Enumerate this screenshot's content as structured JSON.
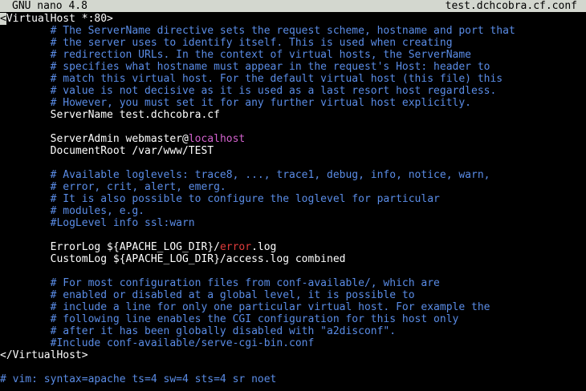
{
  "titlebar": {
    "app": "GNU nano 4.8",
    "filename": "test.dchcobra.cf.conf"
  },
  "colors": {
    "titlebar_bg": "#d3d7cf",
    "background": "#000000",
    "comment": "#5a8ce6",
    "text": "#ffffff",
    "host_highlight": "#d362ce",
    "error_highlight": "#e03c3c"
  },
  "editor": {
    "cursor_char": "<",
    "lines": [
      {
        "segments": [
          {
            "text": "VirtualHost *:80>",
            "style": "plain"
          }
        ],
        "cursor": true
      },
      {
        "segments": [
          {
            "text": "        # The ServerName directive sets the request scheme, hostname and port that",
            "style": "comment"
          }
        ]
      },
      {
        "segments": [
          {
            "text": "        # the server uses to identify itself. This is used when creating",
            "style": "comment"
          }
        ]
      },
      {
        "segments": [
          {
            "text": "        # redirection URLs. In the context of virtual hosts, the ServerName",
            "style": "comment"
          }
        ]
      },
      {
        "segments": [
          {
            "text": "        # specifies what hostname must appear in the request's Host: header to",
            "style": "comment"
          }
        ]
      },
      {
        "segments": [
          {
            "text": "        # match this virtual host. For the default virtual host (this file) this",
            "style": "comment"
          }
        ]
      },
      {
        "segments": [
          {
            "text": "        # value is not decisive as it is used as a last resort host regardless.",
            "style": "comment"
          }
        ]
      },
      {
        "segments": [
          {
            "text": "        # However, you must set it for any further virtual host explicitly.",
            "style": "comment"
          }
        ]
      },
      {
        "segments": [
          {
            "text": "        ServerName test.dchcobra.cf",
            "style": "plain"
          }
        ]
      },
      {
        "segments": []
      },
      {
        "segments": [
          {
            "text": "        ServerAdmin webmaster@",
            "style": "plain"
          },
          {
            "text": "localhost",
            "style": "host"
          }
        ]
      },
      {
        "segments": [
          {
            "text": "        DocumentRoot /var/www/TEST",
            "style": "plain"
          }
        ]
      },
      {
        "segments": []
      },
      {
        "segments": [
          {
            "text": "        # Available loglevels: trace8, ..., trace1, debug, info, notice, warn,",
            "style": "comment"
          }
        ]
      },
      {
        "segments": [
          {
            "text": "        # error, crit, alert, emerg.",
            "style": "comment"
          }
        ]
      },
      {
        "segments": [
          {
            "text": "        # It is also possible to configure the loglevel for particular",
            "style": "comment"
          }
        ]
      },
      {
        "segments": [
          {
            "text": "        # modules, e.g.",
            "style": "comment"
          }
        ]
      },
      {
        "segments": [
          {
            "text": "        #LogLevel info ssl:warn",
            "style": "comment"
          }
        ]
      },
      {
        "segments": []
      },
      {
        "segments": [
          {
            "text": "        ErrorLog ${APACHE_LOG_DIR}/",
            "style": "plain"
          },
          {
            "text": "error",
            "style": "error"
          },
          {
            "text": ".log",
            "style": "plain"
          }
        ]
      },
      {
        "segments": [
          {
            "text": "        CustomLog ${APACHE_LOG_DIR}/access.log combined",
            "style": "plain"
          }
        ]
      },
      {
        "segments": []
      },
      {
        "segments": [
          {
            "text": "        # For most configuration files from conf-available/, which are",
            "style": "comment"
          }
        ]
      },
      {
        "segments": [
          {
            "text": "        # enabled or disabled at a global level, it is possible to",
            "style": "comment"
          }
        ]
      },
      {
        "segments": [
          {
            "text": "        # include a line for only one particular virtual host. For example the",
            "style": "comment"
          }
        ]
      },
      {
        "segments": [
          {
            "text": "        # following line enables the CGI configuration for this host only",
            "style": "comment"
          }
        ]
      },
      {
        "segments": [
          {
            "text": "        # after it has been globally disabled with \"a2disconf\".",
            "style": "comment"
          }
        ]
      },
      {
        "segments": [
          {
            "text": "        #Include conf-available/serve-cgi-bin.conf",
            "style": "comment"
          }
        ]
      },
      {
        "segments": [
          {
            "text": "</VirtualHost>",
            "style": "plain"
          }
        ]
      },
      {
        "segments": []
      },
      {
        "segments": [
          {
            "text": "# vim: syntax=apache ts=4 sw=4 sts=4 sr noet",
            "style": "comment"
          }
        ]
      }
    ]
  }
}
